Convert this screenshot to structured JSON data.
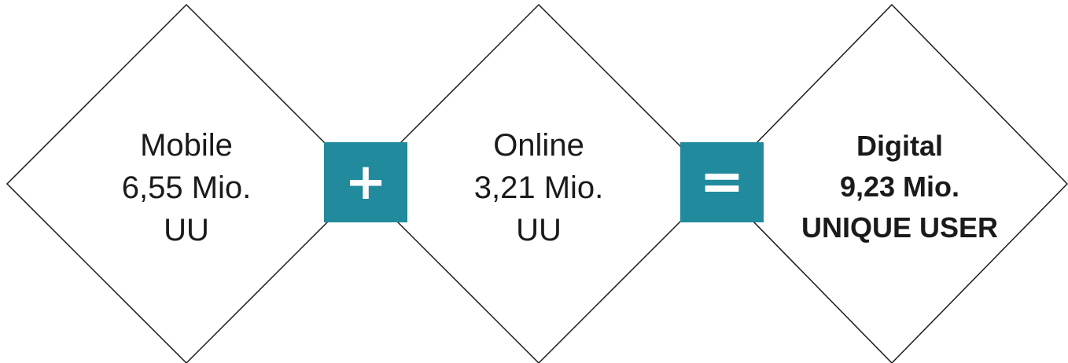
{
  "colors": {
    "accent": "#218a9c",
    "outline": "#1a1a1a",
    "background": "#ffffff"
  },
  "mobile": {
    "title": "Mobile",
    "value": "6,55 Mio.",
    "unit": "UU"
  },
  "plus_operator": "+",
  "online": {
    "title": "Online",
    "value": "3,21 Mio.",
    "unit": "UU"
  },
  "equals_operator": "=",
  "digital": {
    "title": "Digital",
    "value": "9,23 Mio.",
    "unit": "UNIQUE USER"
  }
}
